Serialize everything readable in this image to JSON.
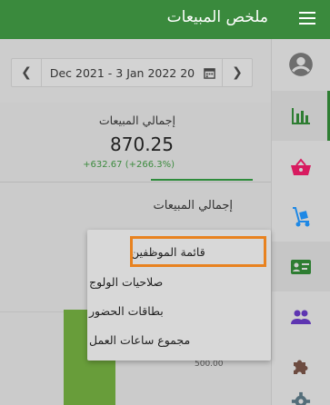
{
  "header": {
    "title": "ملخص المبيعات",
    "menu_icon": "hamburger-menu-icon",
    "background": "#3a8a3d"
  },
  "date_nav": {
    "range_label": "Dec 2021 - 3 Jan 2022 20",
    "prev_icon": "chevron-left-icon",
    "next_icon": "chevron-right-icon",
    "calendar_icon": "calendar-icon"
  },
  "kpi": {
    "label": "إجمالي المبيعات",
    "value": "870.25",
    "change": "+632.67 (+266.3%)",
    "change_color": "#3d8b3f"
  },
  "chart_card": {
    "title": "إجمالي المبيعات",
    "tick_label": "500.00",
    "bar_color": "#689d3a"
  },
  "dropdown": {
    "items": [
      {
        "label": "قائمة الموظفين",
        "highlighted": true
      },
      {
        "label": "صلاحيات الولوج"
      },
      {
        "label": "بطاقات الحضور"
      },
      {
        "label": "مجموع ساعات العمل"
      }
    ],
    "highlight_color": "#e8821f"
  },
  "rail": {
    "items": [
      {
        "icon": "account-circle-icon",
        "color": "#6e6e6e"
      },
      {
        "icon": "bar-chart-icon",
        "color": "#2e7d32"
      },
      {
        "icon": "shopping-basket-icon",
        "color": "#d81b60"
      },
      {
        "icon": "hand-truck-icon",
        "color": "#1e88e5"
      },
      {
        "icon": "badge-card-icon",
        "color": "#2e7d32"
      },
      {
        "icon": "people-icon",
        "color": "#5e35b1"
      },
      {
        "icon": "puzzle-icon",
        "color": "#6d4c41"
      },
      {
        "icon": "gear-icon",
        "color": "#546e7a"
      }
    ]
  }
}
